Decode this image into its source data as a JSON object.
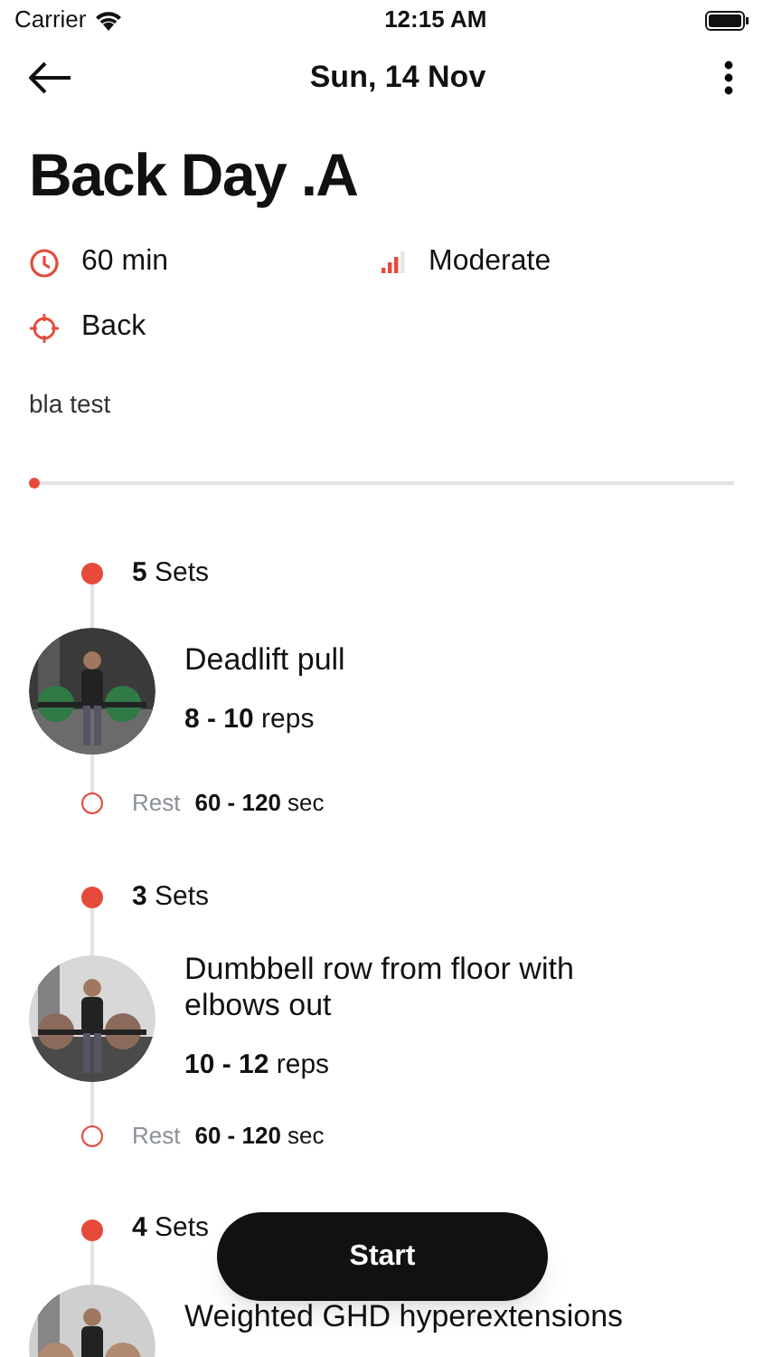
{
  "status_bar": {
    "carrier": "Carrier",
    "time": "12:15 AM"
  },
  "nav": {
    "title": "Sun, 14 Nov"
  },
  "workout": {
    "title": "Back Day .A",
    "duration": "60 min",
    "difficulty": "Moderate",
    "muscle": "Back",
    "note": "bla test"
  },
  "exercises": [
    {
      "sets": "**5** Sets",
      "name": "Deadlift pull",
      "reps": "**8 - 10** reps",
      "rest_label": "Rest",
      "rest": "**60 - 120** sec"
    },
    {
      "sets": "**3** Sets",
      "name": "Dumbbell row from floor with elbows out",
      "reps": "**10 - 12** reps",
      "rest_label": "Rest",
      "rest": "**60 - 120** sec"
    },
    {
      "sets": "**4** Sets",
      "name": "Weighted GHD hyperextensions"
    }
  ],
  "start_button": {
    "label": "Start"
  }
}
